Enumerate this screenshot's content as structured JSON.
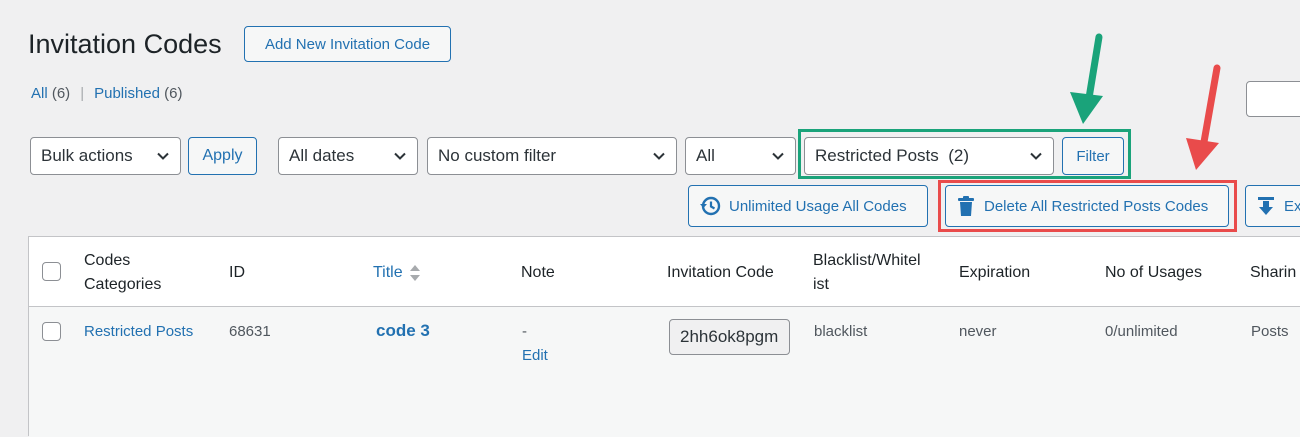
{
  "header": {
    "title": "Invitation Codes",
    "add_new_label": "Add New Invitation Code"
  },
  "views": {
    "all_label": "All",
    "all_count": "(6)",
    "separator": "|",
    "published_label": "Published",
    "published_count": "(6)"
  },
  "filters": {
    "bulk_actions": "Bulk actions",
    "apply_label": "Apply",
    "dates": "All dates",
    "custom_filter": "No custom filter",
    "all": "All",
    "category": "Restricted Posts  (2)",
    "filter_label": "Filter"
  },
  "actions": {
    "unlimited_usage_label": "Unlimited Usage All Codes",
    "delete_restricted_label": "Delete All Restricted Posts Codes",
    "export_label": "Ex"
  },
  "table": {
    "columns": {
      "categories_line1": "Codes",
      "categories_line2": "Categories",
      "id": "ID",
      "title": "Title",
      "note": "Note",
      "invitation_code": "Invitation Code",
      "blacklist_line1": "Blacklist/Whitel",
      "blacklist_line2": "ist",
      "expiration": "Expiration",
      "usages": "No of Usages",
      "sharing": "Sharin"
    },
    "rows": [
      {
        "category": "Restricted Posts",
        "id": "68631",
        "title": "code 3",
        "note": "-",
        "edit_label": "Edit",
        "code": "2hh6ok8pgm",
        "list_type": "blacklist",
        "expiration": "never",
        "usages": "0/unlimited",
        "sharing": "Posts"
      }
    ]
  },
  "colors": {
    "accent": "#2271b1",
    "annotation_green": "#1aa37a",
    "annotation_red": "#e94b4b"
  }
}
